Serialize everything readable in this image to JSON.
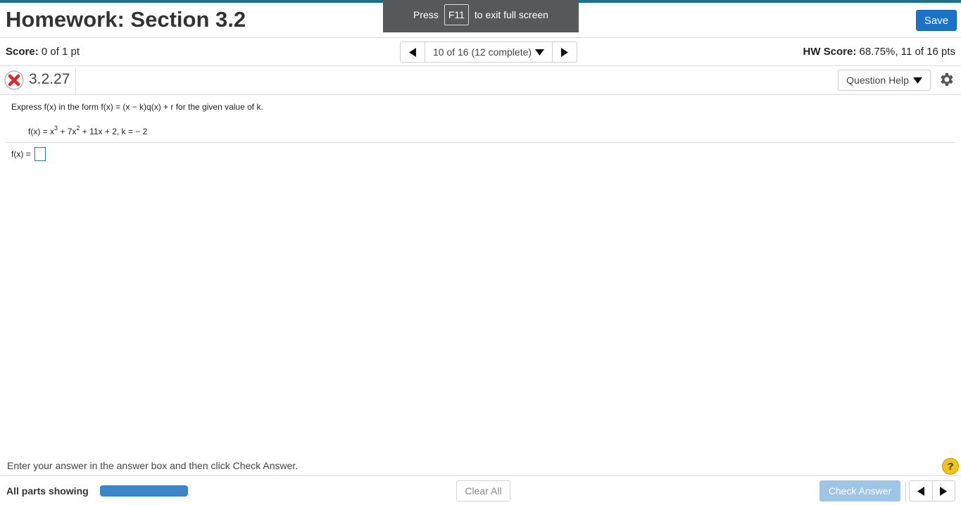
{
  "header": {
    "title": "Homework: Section 3.2",
    "save_label": "Save"
  },
  "fullscreen_banner": {
    "press": "Press",
    "key": "F11",
    "rest": "to exit full screen"
  },
  "status_bar": {
    "score_label": "Score:",
    "score_value": "0 of 1 pt",
    "nav_label": "10 of 16 (12 complete)",
    "hw_score_label": "HW Score:",
    "hw_score_value": "68.75%, 11 of 16 pts"
  },
  "question": {
    "id": "3.2.27",
    "status_icon": "x-icon",
    "help_label": "Question Help",
    "instruction": "Express f(x) in the form f(x) = (x − k)q(x) + r for the given value of k.",
    "expr_prefix": "f(x) = x",
    "expr_exp1": "3",
    "expr_mid": " + 7x",
    "expr_exp2": "2",
    "expr_suffix": " + 11x + 2, k = − 2",
    "answer_label": "f(x) =",
    "answer_value": ""
  },
  "footer": {
    "message": "Enter your answer in the answer box and then click Check Answer.",
    "parts_label": "All parts showing",
    "progress_fraction": 1.0,
    "clear_label": "Clear All",
    "check_label": "Check Answer"
  },
  "colors": {
    "accent": "#1a73c8",
    "top_rule": "#1f6f8e",
    "progress": "#3a86c8",
    "error": "#d9282f",
    "help": "#f1c21b"
  }
}
